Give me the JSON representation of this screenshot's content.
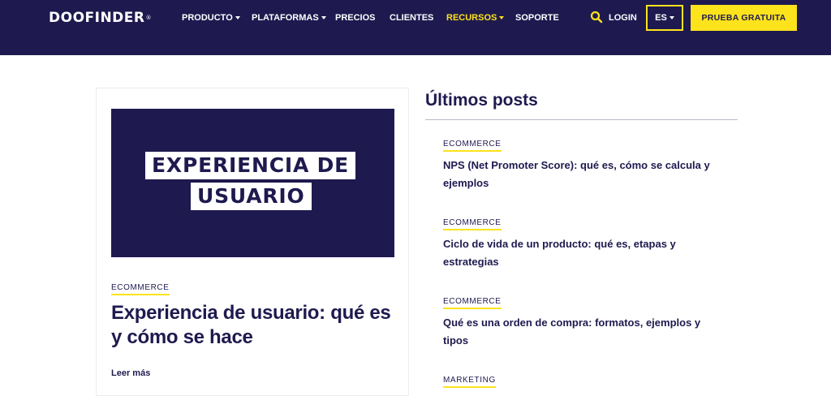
{
  "brand": {
    "logo_text": "DOOFINDER",
    "logo_mark": "®",
    "colors": {
      "navy": "#1e1a4f",
      "yellow": "#fde31c",
      "white": "#ffffff"
    }
  },
  "nav": {
    "items": [
      {
        "label": "PRODUCTO",
        "has_dropdown": true,
        "active": false
      },
      {
        "label": "PLATAFORMAS",
        "has_dropdown": true,
        "active": false
      },
      {
        "label": "PRECIOS",
        "has_dropdown": false,
        "active": false
      },
      {
        "label": "CLIENTES",
        "has_dropdown": false,
        "active": false
      },
      {
        "label": "RECURSOS",
        "has_dropdown": true,
        "active": true
      },
      {
        "label": "SOPORTE",
        "has_dropdown": false,
        "active": false
      }
    ],
    "search_icon": "search-icon",
    "login_label": "LOGIN",
    "language_label": "ES",
    "cta_label": "PRUEBA GRATUITA"
  },
  "featured": {
    "hero_line_1": "EXPERIENCIA DE",
    "hero_line_2": "USUARIO",
    "category": "ECOMMERCE",
    "title": "Experiencia de usuario: qué es y cómo se hace",
    "read_more": "Leer más"
  },
  "latest": {
    "heading": "Últimos posts",
    "posts": [
      {
        "category": "ECOMMERCE",
        "title": "NPS (Net Promoter Score): qué es, cómo se calcula y ejemplos"
      },
      {
        "category": "ECOMMERCE",
        "title": "Ciclo de vida de un producto: qué es, etapas y estrategias"
      },
      {
        "category": "ECOMMERCE",
        "title": "Qué es una orden de compra: formatos, ejemplos y tipos"
      },
      {
        "category": "MARKETING",
        "title": ""
      }
    ]
  }
}
